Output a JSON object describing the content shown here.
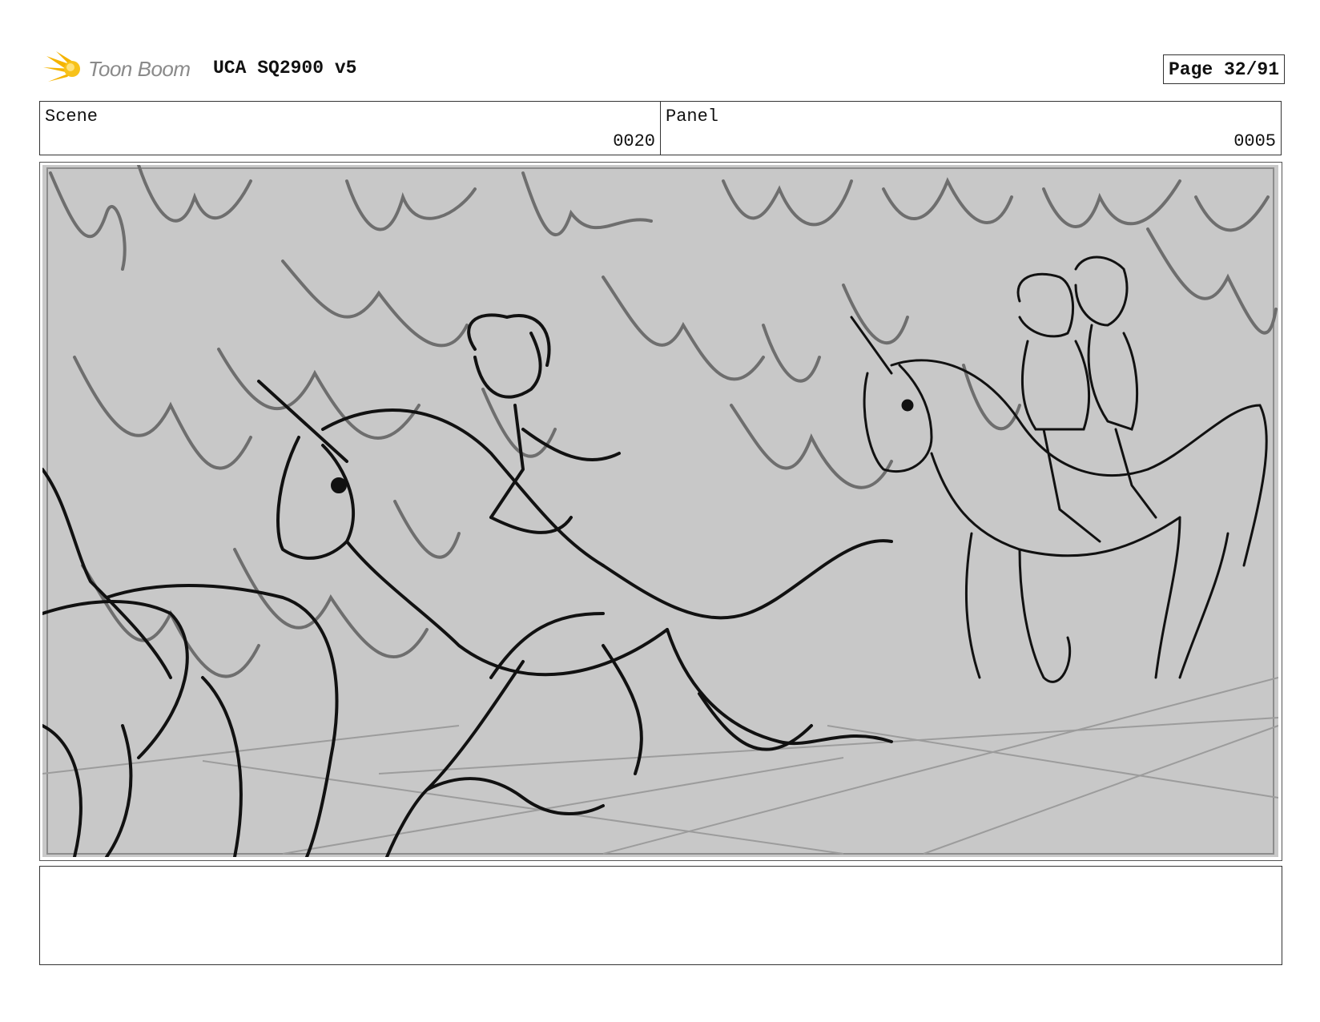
{
  "header": {
    "logo_text": "Toon Boom",
    "title": "UCA SQ2900 v5",
    "page_label": "Page 32/91"
  },
  "info": {
    "scene_label": "Scene",
    "scene_value": "0020",
    "panel_label": "Panel",
    "panel_value": "0005"
  },
  "panel": {
    "description_icon": "storyboard-sketch-three-unicorn-riders-in-forest",
    "background_color": "#c8c8c8"
  },
  "notes": {
    "text": ""
  },
  "colors": {
    "logo_accent": "#f5b400",
    "frame": "#333333"
  }
}
